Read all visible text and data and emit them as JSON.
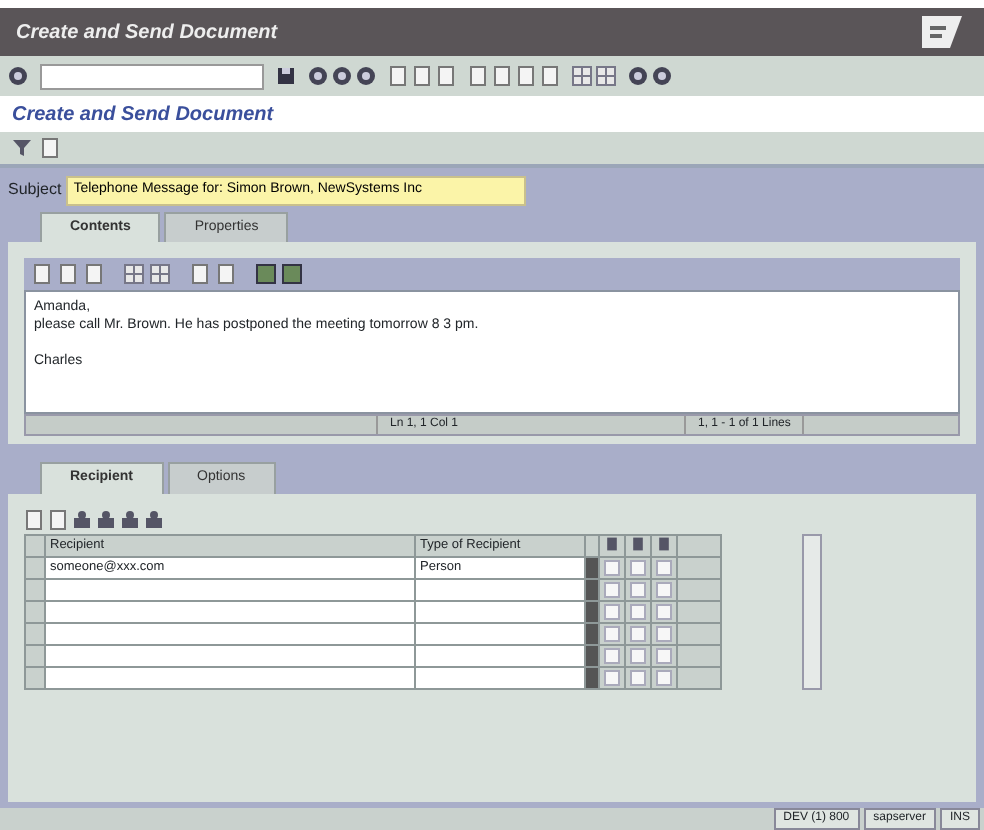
{
  "window": {
    "title": "Create and Send Document"
  },
  "screen_title": "Create and Send Document",
  "subject": {
    "label": "Subject",
    "value": "Telephone Message for: Simon Brown, NewSystems Inc"
  },
  "document_tabs": [
    {
      "label": "Contents",
      "selected": true
    },
    {
      "label": "Properties",
      "selected": false
    }
  ],
  "body": {
    "lines": [
      "Amanda,",
      "please call Mr. Brown. He has postponed the meeting tomorrow 8 3 pm."
    ],
    "closing": "Charles",
    "position": "Ln 1, 1 Col 1",
    "lines_info": "1, 1 - 1 of 1 Lines"
  },
  "recipient_tabs": [
    {
      "label": "Recipient",
      "selected": true
    },
    {
      "label": "Options",
      "selected": false
    }
  ],
  "table": {
    "columns": [
      "Recipient",
      "Type of Recipient"
    ],
    "rows": [
      {
        "recipient": "someone@xxx.com",
        "type": "Person",
        "flags": [
          false,
          false,
          false
        ]
      },
      {
        "flags": [
          false,
          false,
          false
        ]
      },
      {
        "flags": [
          false,
          false,
          false
        ]
      },
      {
        "flags": [
          false,
          false,
          false
        ]
      },
      {
        "flags": [
          false,
          false,
          false
        ]
      },
      {
        "flags": [
          false,
          false,
          false
        ]
      }
    ]
  },
  "status_bar": [
    "DEV (1) 800",
    "sapserver",
    "INS"
  ]
}
